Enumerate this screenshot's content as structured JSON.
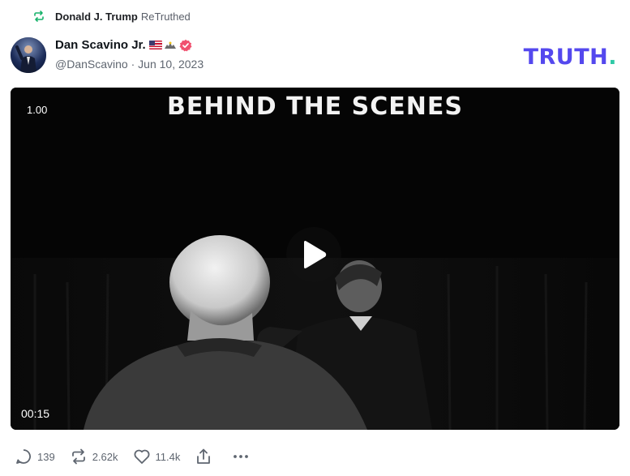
{
  "retruth": {
    "icon": "retruth-icon",
    "user": "Donald J. Trump",
    "verb": "ReTruthed"
  },
  "author": {
    "name": "Dan Scavino Jr.",
    "badges": [
      "us-flag-icon",
      "eagle-icon",
      "verified-badge-icon"
    ],
    "handle": "@DanScavino",
    "separator": "·",
    "date": "Jun 10, 2023"
  },
  "brand": {
    "logo_text": "TRUTH",
    "logo_dot": ".",
    "color": "#5448ee",
    "dot_color": "#2fc9a6"
  },
  "video": {
    "overlay_title": "BEHIND THE SCENES",
    "playback_speed": "1.00",
    "duration": "00:15",
    "play_icon": "play-icon"
  },
  "actions": {
    "replies": "139",
    "retruths": "2.62k",
    "likes": "11.4k",
    "share_icon": "share-icon",
    "more_icon": "more-icon"
  },
  "colors": {
    "retruth_green": "#17b26a",
    "verified_pink": "#f0506e",
    "muted_text": "#5f6670"
  }
}
